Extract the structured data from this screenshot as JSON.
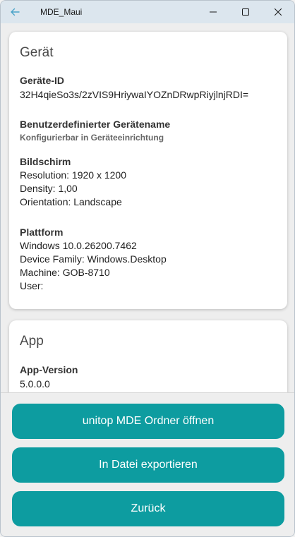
{
  "window": {
    "title": "MDE_Maui"
  },
  "device_card": {
    "title": "Gerät",
    "device_id_label": "Geräte-ID",
    "device_id_value": "32H4qieSo3s/2zVIS9HriywaIYOZnDRwpRiyjlnjRDI=",
    "custom_name_label": "Benutzerdefinierter Gerätename",
    "custom_name_hint": "Konfigurierbar in Geräteeinrichtung",
    "screen_label": "Bildschirm",
    "screen_lines": [
      "Resolution: 1920 x 1200",
      "Density: 1,00",
      "Orientation: Landscape"
    ],
    "platform_label": "Plattform",
    "platform_lines": [
      "Windows 10.0.26200.7462",
      "Device Family: Windows.Desktop",
      "Machine: GOB-8710",
      "User:"
    ]
  },
  "app_card": {
    "title": "App",
    "version_label": "App-Version",
    "version_value": "5.0.0.0"
  },
  "buttons": {
    "open_folder": "unitop MDE Ordner öffnen",
    "export": "In Datei exportieren",
    "back": "Zurück"
  },
  "colors": {
    "accent": "#0d9ca0",
    "titlebar": "#dce6ee"
  }
}
